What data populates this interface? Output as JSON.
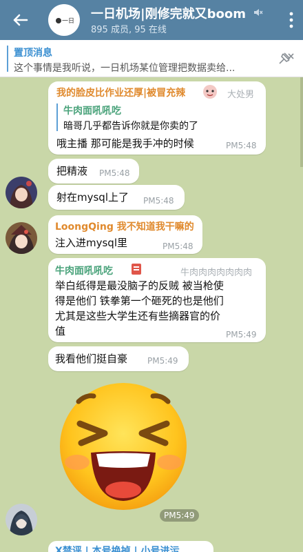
{
  "header": {
    "title": "一日机场|刚修完就又boom",
    "subtitle": "895 成员, 95 在线",
    "avatar_text": "一日"
  },
  "pinned": {
    "title": "置顶消息",
    "text": "这个事情是我听说，一日机场某位管理把数据卖给..."
  },
  "messages": [
    {
      "name": "我的脸皮比作业还厚|被冒充辣",
      "rank": "大处男",
      "reply_name": "牛肉面吼吼吃",
      "reply_text": "暗哥几乎都告诉你就是你卖的了",
      "text": "哦主播 那可能是我手冲的时候",
      "time": "PM5:48"
    },
    {
      "text": "把精液",
      "time": "PM5:48"
    },
    {
      "text": "射在mysql上了",
      "time": "PM5:48"
    },
    {
      "name": "LoongQing 我不知道我干嘛的",
      "text": "注入进mysql里",
      "time": "PM5:48"
    },
    {
      "name": "牛肉面吼吼吃",
      "rank": "牛肉肉肉肉肉肉肉",
      "lines": [
        "举白纸得是最没脑子的反贼 被当枪使",
        "得是他们 铁拳第一个砸死的也是他们",
        "尤其是这些大学生还有些摘器官的价",
        "值"
      ],
      "time": "PM5:49"
    },
    {
      "text": "我看他们挺自豪",
      "time": "PM5:49"
    }
  ],
  "sticker": {
    "time": "PM5:49",
    "emoji": "laughing-face"
  },
  "next_message": {
    "name": "X禁评 | 本号换掉 | 小号进污"
  },
  "colors": {
    "header": "#5682a3",
    "name_orange": "#e08a2e",
    "name_green": "#4aa37b",
    "link_blue": "#3a8fd1"
  }
}
